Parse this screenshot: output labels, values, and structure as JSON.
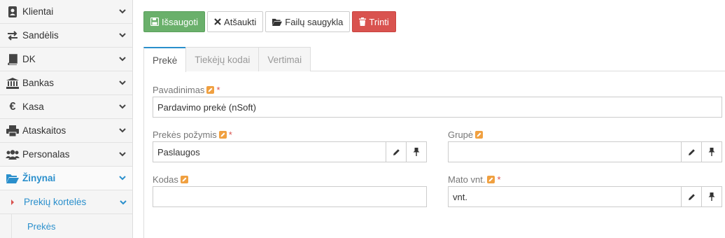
{
  "sidebar": {
    "items": [
      {
        "label": "Klientai",
        "icon": "address-book-icon"
      },
      {
        "label": "Sandėlis",
        "icon": "exchange-arrows-icon"
      },
      {
        "label": "DK",
        "icon": "book-icon"
      },
      {
        "label": "Bankas",
        "icon": "bank-icon"
      },
      {
        "label": "Kasa",
        "icon": "euro-icon"
      },
      {
        "label": "Ataskaitos",
        "icon": "printer-icon"
      },
      {
        "label": "Personalas",
        "icon": "users-icon"
      },
      {
        "label": "Žinynai",
        "icon": "folder-open-icon"
      }
    ],
    "sub_item": "Prekių kortelės",
    "sub_sub_item": "Prekės"
  },
  "toolbar": {
    "save": "Išsaugoti",
    "cancel": "Atšaukti",
    "files": "Failų saugykla",
    "delete": "Trinti"
  },
  "tabs": [
    "Prekė",
    "Tiekėjų kodai",
    "Vertimai"
  ],
  "form": {
    "name_label": "Pavadinimas",
    "name_value": "Pardavimo prekė (nSoft)",
    "feature_label": "Prekės požymis",
    "feature_value": "Paslaugos",
    "group_label": "Grupė",
    "group_value": "",
    "code_label": "Kodas",
    "code_value": "",
    "unit_label": "Mato vnt.",
    "unit_value": "vnt.",
    "required_mark": "*"
  },
  "colors": {
    "accent": "#2a8fcc",
    "success": "#6ab06b",
    "danger": "#d9534f",
    "edit_badge": "#f0a040"
  }
}
